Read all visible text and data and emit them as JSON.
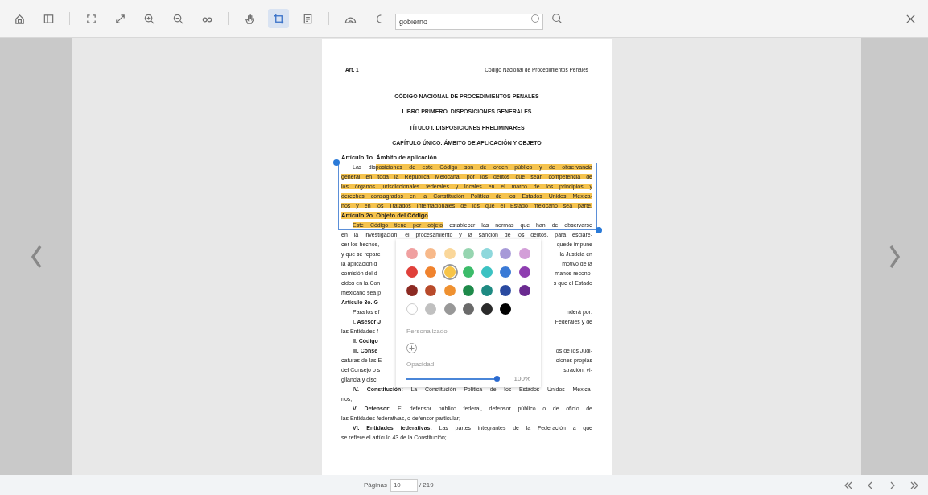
{
  "toolbar": {
    "tools": [
      {
        "kind": "home",
        "selected": false
      },
      {
        "kind": "sidebar",
        "selected": false
      },
      {
        "kind": "fit",
        "selected": false
      },
      {
        "kind": "diagonal",
        "selected": false
      },
      {
        "kind": "zoomin",
        "selected": false
      },
      {
        "kind": "zoomout",
        "selected": false
      },
      {
        "kind": "glasses",
        "selected": false
      },
      {
        "kind": "hand",
        "selected": false
      },
      {
        "kind": "select",
        "selected": true
      },
      {
        "kind": "doc",
        "selected": false
      },
      {
        "kind": "cloud",
        "selected": false
      },
      {
        "kind": "moon",
        "selected": false
      }
    ],
    "search": {
      "value": "gobierno"
    }
  },
  "document": {
    "header_left": "Art. 1",
    "header_right": "Código Nacional de Procedimientos Penales",
    "titles": [
      "CÓDIGO NACIONAL DE PROCEDIMIENTOS PENALES",
      "LIBRO PRIMERO. DISPOSICIONES GENERALES",
      "TÍTULO I. DISPOSICIONES PRELIMINARES",
      "CAPÍTULO ÚNICO. ÁMBITO DE APLICACIÓN Y OBJETO"
    ],
    "lines": [
      {
        "kind": "heading",
        "indent": false,
        "segments": [
          {
            "text": "Artículo 1o. Ámbito de aplicación",
            "highlighted": false
          }
        ]
      },
      {
        "kind": "text",
        "indent": true,
        "segments": [
          {
            "text": "Las dis",
            "highlighted": false
          },
          {
            "text": "posiciones de este Código son de orden público y de observancia",
            "highlighted": true
          }
        ]
      },
      {
        "kind": "text",
        "indent": false,
        "segments": [
          {
            "text": "general en toda la República Mexicana, por los delitos que sean competencia de",
            "highlighted": true
          }
        ]
      },
      {
        "kind": "text",
        "indent": false,
        "segments": [
          {
            "text": "los órganos jurisdiccionales federales y locales en el marco de los principios y",
            "highlighted": true
          }
        ]
      },
      {
        "kind": "text",
        "indent": false,
        "segments": [
          {
            "text": "derechos consagrados en la Constitución Política de los Estados Unidos Mexica-",
            "highlighted": true
          }
        ]
      },
      {
        "kind": "text",
        "indent": false,
        "segments": [
          {
            "text": "nos y en los Tratados Internacionales de los que el Estado mexicano sea parte.",
            "highlighted": true
          }
        ]
      },
      {
        "kind": "heading",
        "indent": false,
        "segments": [
          {
            "text": "Artículo 2o. Objeto del Código",
            "highlighted": true
          }
        ]
      },
      {
        "kind": "text",
        "indent": true,
        "segments": [
          {
            "text": "Este Código tiene por objeto",
            "highlighted": true
          },
          {
            "text": " establecer las normas que han de observarse",
            "highlighted": false
          }
        ]
      },
      {
        "kind": "text",
        "indent": false,
        "segments": [
          {
            "text": "en la investigación, el procesamiento y la sanción de los delitos, para esclare-",
            "highlighted": false
          }
        ]
      },
      {
        "kind": "split",
        "indent": false,
        "left": "cer los hechos,",
        "right": "quede impune"
      },
      {
        "kind": "split",
        "indent": false,
        "left": "y que se repare",
        "right": "la Justicia en"
      },
      {
        "kind": "split",
        "indent": false,
        "left": "la aplicación d",
        "right": "motivo de la"
      },
      {
        "kind": "split",
        "indent": false,
        "left": "comisión del d",
        "right": "manos recono-"
      },
      {
        "kind": "split",
        "indent": false,
        "left": "cidos en la Con",
        "right": "s que el Estado"
      },
      {
        "kind": "split",
        "indent": false,
        "left": "mexicano sea p"
      },
      {
        "kind": "split",
        "indent": false,
        "left": "**Artículo 3o. G**"
      },
      {
        "kind": "split",
        "indent": true,
        "left": "Para los ef",
        "right": "nderá por:"
      },
      {
        "kind": "split",
        "indent": true,
        "left": "**I. Asesor J**",
        "right": "Federales y de"
      },
      {
        "kind": "split",
        "indent": false,
        "left": "las Entidades f"
      },
      {
        "kind": "split",
        "indent": true,
        "left": "**II. Código**"
      },
      {
        "kind": "split",
        "indent": true,
        "left": "**III. Conse**",
        "right": "os de los Judi-"
      },
      {
        "kind": "split",
        "indent": false,
        "left": "caturas de las E",
        "right": "ciones propias"
      },
      {
        "kind": "split",
        "indent": false,
        "left": "del Consejo o s",
        "right": "istración, vi-"
      },
      {
        "kind": "split",
        "indent": false,
        "left": "gilancia y disc"
      },
      {
        "kind": "text",
        "indent": true,
        "segments": [
          {
            "text": "**IV. Constitución:** La Constitución Política de los Estados Unidos Mexica-",
            "highlighted": false
          }
        ]
      },
      {
        "kind": "last",
        "indent": false,
        "segments": [
          {
            "text": "nos;",
            "highlighted": false
          }
        ]
      },
      {
        "kind": "text",
        "indent": true,
        "segments": [
          {
            "text": "**V. Defensor:** El defensor público federal, defensor público o de oficio de",
            "highlighted": false
          }
        ]
      },
      {
        "kind": "last",
        "indent": false,
        "segments": [
          {
            "text": "las Entidades federativas, o defensor particular;",
            "highlighted": false
          }
        ]
      },
      {
        "kind": "text",
        "indent": true,
        "segments": [
          {
            "text": "**VI. Entidades federativas:** Las partes integrantes de la Federación a que",
            "highlighted": false
          }
        ]
      },
      {
        "kind": "last",
        "indent": false,
        "segments": [
          {
            "text": "se refiere el artículo 43 de la Constitución;",
            "highlighted": false
          }
        ]
      }
    ]
  },
  "color_picker": {
    "swatches": [
      {
        "color": "#f0a0a0",
        "selected": false
      },
      {
        "color": "#f7b98a",
        "selected": false
      },
      {
        "color": "#fad79a",
        "selected": false
      },
      {
        "color": "#96d5b0",
        "selected": false
      },
      {
        "color": "#8ed8dc",
        "selected": false
      },
      {
        "color": "#a79ad8",
        "selected": false
      },
      {
        "color": "#d39ed8",
        "selected": false
      },
      {
        "color": "#e0403a",
        "selected": false
      },
      {
        "color": "#f0832e",
        "selected": false
      },
      {
        "color": "#f7c447",
        "selected": true
      },
      {
        "color": "#3cbc6a",
        "selected": false
      },
      {
        "color": "#3cc2c2",
        "selected": false
      },
      {
        "color": "#3a7ad6",
        "selected": false
      },
      {
        "color": "#8e3db0",
        "selected": false
      },
      {
        "color": "#8c2a22",
        "selected": false
      },
      {
        "color": "#b84a2a",
        "selected": false
      },
      {
        "color": "#ef9130",
        "selected": false
      },
      {
        "color": "#1e8a4a",
        "selected": false
      },
      {
        "color": "#1e8a82",
        "selected": false
      },
      {
        "color": "#2a4aa0",
        "selected": false
      },
      {
        "color": "#6a2a90",
        "selected": false
      },
      {
        "color": "#ffffff",
        "selected": false
      },
      {
        "color": "#c0c0c0",
        "selected": false
      },
      {
        "color": "#989898",
        "selected": false
      },
      {
        "color": "#6a6a6a",
        "selected": false
      },
      {
        "color": "#2a2a2a",
        "selected": false
      },
      {
        "color": "#000000",
        "selected": false
      }
    ],
    "custom_label": "Personalizado",
    "opacity_label": "Opacidad",
    "opacity": {
      "level": 0.98
    },
    "opacity_reading": "100%"
  },
  "footer": {
    "pages_label": "Páginas",
    "page_value": "10",
    "page_total": "/ 219"
  }
}
